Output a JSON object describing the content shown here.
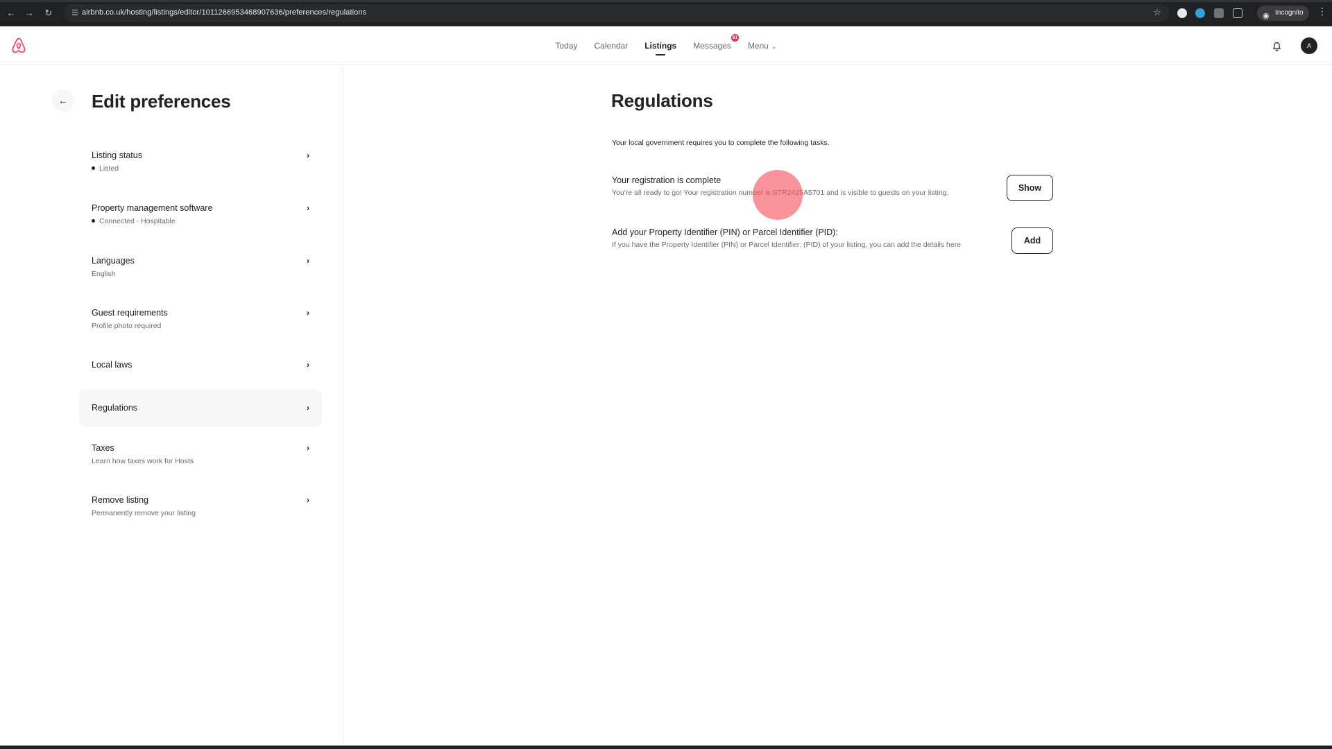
{
  "browser": {
    "url": "airbnb.co.uk/hosting/listings/editor/1011266953468907636/preferences/regulations",
    "incognito_label": "Incognito"
  },
  "header": {
    "nav": [
      {
        "label": "Today",
        "active": false
      },
      {
        "label": "Calendar",
        "active": false
      },
      {
        "label": "Listings",
        "active": true
      },
      {
        "label": "Messages",
        "active": false,
        "badge": "91"
      },
      {
        "label": "Menu",
        "active": false
      }
    ],
    "avatar_initial": "A",
    "brand_color": "#FF385C"
  },
  "left_panel": {
    "title": "Edit preferences",
    "items": [
      {
        "label": "Listing status",
        "sub": "Listed",
        "dot": true
      },
      {
        "label": "Property management software",
        "sub": "Connected · Hospitable",
        "dot": true
      },
      {
        "label": "Languages",
        "sub": "English",
        "dot": false
      },
      {
        "label": "Guest requirements",
        "sub": "Profile photo required",
        "dot": false
      },
      {
        "label": "Local laws",
        "sub": "",
        "dot": false
      },
      {
        "label": "Regulations",
        "sub": "",
        "dot": false,
        "selected": true
      },
      {
        "label": "Taxes",
        "sub": "Learn how taxes work for Hosts",
        "dot": false
      },
      {
        "label": "Remove listing",
        "sub": "Permanently remove your listing",
        "dot": false
      }
    ]
  },
  "main": {
    "title": "Regulations",
    "intro": "Your local government requires you to complete the following tasks.",
    "tasks": [
      {
        "title": "Your registration is complete",
        "desc": "You're all ready to go! Your registration number is STR2425A5701 and is visible to guests on your listing.",
        "button": "Show"
      },
      {
        "title": "Add your Property Identifier (PIN) or Parcel Identifier (PID):",
        "desc": "If you have the Property Identifier (PIN) or Parcel Identifier: (PID) of your listing, you can add the details here",
        "button": "Add"
      }
    ]
  }
}
